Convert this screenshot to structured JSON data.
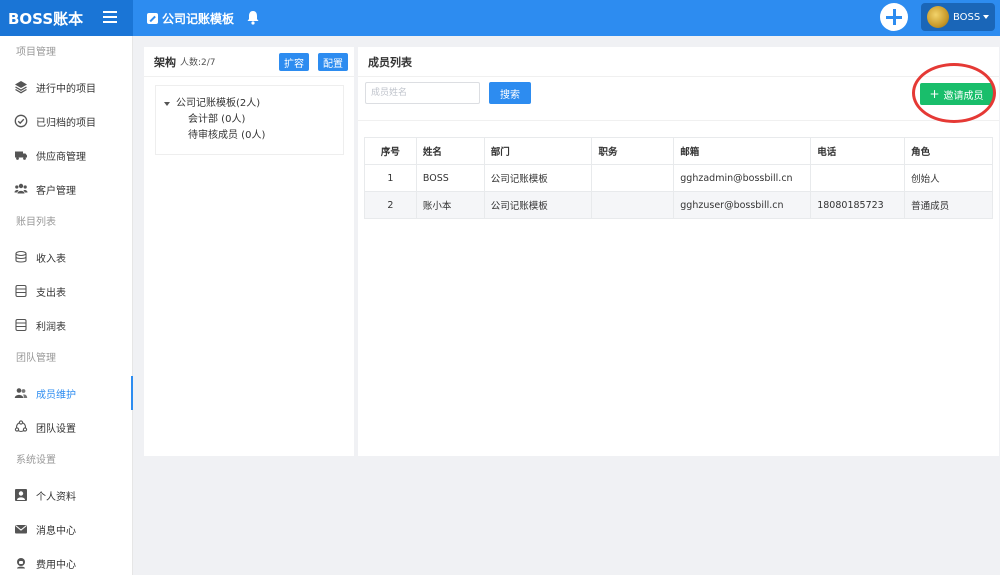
{
  "brand": "BOSS账本",
  "topbar": {
    "title": "公司记账模板",
    "user": "BOSS"
  },
  "sidebar": {
    "groups": [
      {
        "title": "项目管理",
        "items": [
          {
            "label": "进行中的项目",
            "icon": "layers-icon"
          },
          {
            "label": "已归档的项目",
            "icon": "check-circle-icon"
          },
          {
            "label": "供应商管理",
            "icon": "truck-icon"
          },
          {
            "label": "客户管理",
            "icon": "users-icon"
          }
        ]
      },
      {
        "title": "账目列表",
        "items": [
          {
            "label": "收入表",
            "icon": "database-icon"
          },
          {
            "label": "支出表",
            "icon": "database-icon"
          },
          {
            "label": "利润表",
            "icon": "database-icon"
          }
        ]
      },
      {
        "title": "团队管理",
        "items": [
          {
            "label": "成员维护",
            "icon": "team-icon",
            "active": true
          },
          {
            "label": "团队设置",
            "icon": "network-icon"
          }
        ]
      },
      {
        "title": "系统设置",
        "items": [
          {
            "label": "个人资料",
            "icon": "profile-icon"
          },
          {
            "label": "消息中心",
            "icon": "envelope-icon"
          },
          {
            "label": "费用中心",
            "icon": "support-icon"
          }
        ]
      }
    ]
  },
  "org": {
    "title": "架构",
    "count": "人数:2/7",
    "expand_btn": "扩容",
    "config_btn": "配置",
    "root": "公司记账模板(2人)",
    "children": [
      "会计部 (0人)",
      "待审核成员 (0人)"
    ]
  },
  "members": {
    "title": "成员列表",
    "search_placeholder": "成员姓名",
    "search_btn": "搜索",
    "invite_btn": "邀请成员",
    "columns": [
      "序号",
      "姓名",
      "部门",
      "职务",
      "邮箱",
      "电话",
      "角色"
    ],
    "rows": [
      [
        "1",
        "BOSS",
        "公司记账模板",
        "",
        "gghzadmin@bossbill.cn",
        "",
        "创始人"
      ],
      [
        "2",
        "账小本",
        "公司记账模板",
        "",
        "gghzuser@bossbill.cn",
        "18080185723",
        "普通成员"
      ]
    ]
  }
}
